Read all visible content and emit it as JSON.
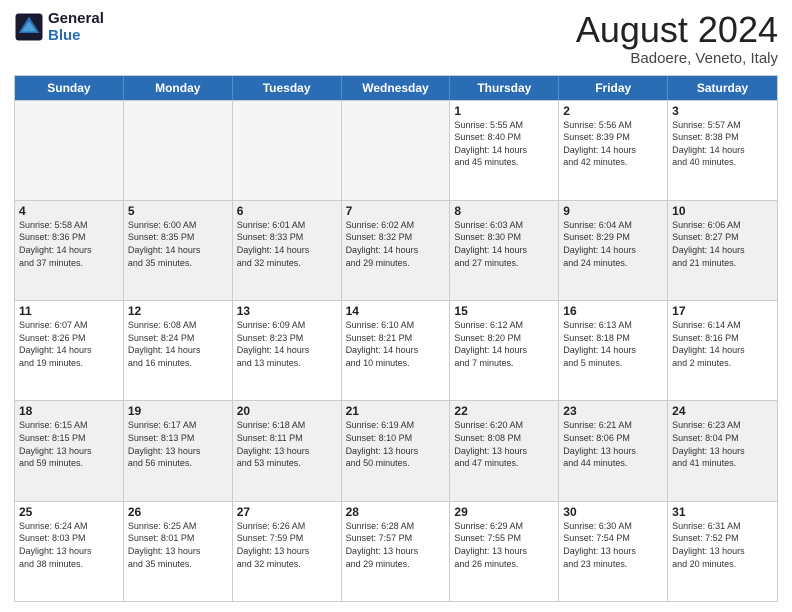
{
  "logo": {
    "line1": "General",
    "line2": "Blue"
  },
  "title": "August 2024",
  "subtitle": "Badoere, Veneto, Italy",
  "days": [
    "Sunday",
    "Monday",
    "Tuesday",
    "Wednesday",
    "Thursday",
    "Friday",
    "Saturday"
  ],
  "rows": [
    [
      {
        "day": "",
        "text": "",
        "empty": true
      },
      {
        "day": "",
        "text": "",
        "empty": true
      },
      {
        "day": "",
        "text": "",
        "empty": true
      },
      {
        "day": "",
        "text": "",
        "empty": true
      },
      {
        "day": "1",
        "text": "Sunrise: 5:55 AM\nSunset: 8:40 PM\nDaylight: 14 hours\nand 45 minutes."
      },
      {
        "day": "2",
        "text": "Sunrise: 5:56 AM\nSunset: 8:39 PM\nDaylight: 14 hours\nand 42 minutes."
      },
      {
        "day": "3",
        "text": "Sunrise: 5:57 AM\nSunset: 8:38 PM\nDaylight: 14 hours\nand 40 minutes."
      }
    ],
    [
      {
        "day": "4",
        "text": "Sunrise: 5:58 AM\nSunset: 8:36 PM\nDaylight: 14 hours\nand 37 minutes."
      },
      {
        "day": "5",
        "text": "Sunrise: 6:00 AM\nSunset: 8:35 PM\nDaylight: 14 hours\nand 35 minutes."
      },
      {
        "day": "6",
        "text": "Sunrise: 6:01 AM\nSunset: 8:33 PM\nDaylight: 14 hours\nand 32 minutes."
      },
      {
        "day": "7",
        "text": "Sunrise: 6:02 AM\nSunset: 8:32 PM\nDaylight: 14 hours\nand 29 minutes."
      },
      {
        "day": "8",
        "text": "Sunrise: 6:03 AM\nSunset: 8:30 PM\nDaylight: 14 hours\nand 27 minutes."
      },
      {
        "day": "9",
        "text": "Sunrise: 6:04 AM\nSunset: 8:29 PM\nDaylight: 14 hours\nand 24 minutes."
      },
      {
        "day": "10",
        "text": "Sunrise: 6:06 AM\nSunset: 8:27 PM\nDaylight: 14 hours\nand 21 minutes."
      }
    ],
    [
      {
        "day": "11",
        "text": "Sunrise: 6:07 AM\nSunset: 8:26 PM\nDaylight: 14 hours\nand 19 minutes."
      },
      {
        "day": "12",
        "text": "Sunrise: 6:08 AM\nSunset: 8:24 PM\nDaylight: 14 hours\nand 16 minutes."
      },
      {
        "day": "13",
        "text": "Sunrise: 6:09 AM\nSunset: 8:23 PM\nDaylight: 14 hours\nand 13 minutes."
      },
      {
        "day": "14",
        "text": "Sunrise: 6:10 AM\nSunset: 8:21 PM\nDaylight: 14 hours\nand 10 minutes."
      },
      {
        "day": "15",
        "text": "Sunrise: 6:12 AM\nSunset: 8:20 PM\nDaylight: 14 hours\nand 7 minutes."
      },
      {
        "day": "16",
        "text": "Sunrise: 6:13 AM\nSunset: 8:18 PM\nDaylight: 14 hours\nand 5 minutes."
      },
      {
        "day": "17",
        "text": "Sunrise: 6:14 AM\nSunset: 8:16 PM\nDaylight: 14 hours\nand 2 minutes."
      }
    ],
    [
      {
        "day": "18",
        "text": "Sunrise: 6:15 AM\nSunset: 8:15 PM\nDaylight: 13 hours\nand 59 minutes."
      },
      {
        "day": "19",
        "text": "Sunrise: 6:17 AM\nSunset: 8:13 PM\nDaylight: 13 hours\nand 56 minutes."
      },
      {
        "day": "20",
        "text": "Sunrise: 6:18 AM\nSunset: 8:11 PM\nDaylight: 13 hours\nand 53 minutes."
      },
      {
        "day": "21",
        "text": "Sunrise: 6:19 AM\nSunset: 8:10 PM\nDaylight: 13 hours\nand 50 minutes."
      },
      {
        "day": "22",
        "text": "Sunrise: 6:20 AM\nSunset: 8:08 PM\nDaylight: 13 hours\nand 47 minutes."
      },
      {
        "day": "23",
        "text": "Sunrise: 6:21 AM\nSunset: 8:06 PM\nDaylight: 13 hours\nand 44 minutes."
      },
      {
        "day": "24",
        "text": "Sunrise: 6:23 AM\nSunset: 8:04 PM\nDaylight: 13 hours\nand 41 minutes."
      }
    ],
    [
      {
        "day": "25",
        "text": "Sunrise: 6:24 AM\nSunset: 8:03 PM\nDaylight: 13 hours\nand 38 minutes."
      },
      {
        "day": "26",
        "text": "Sunrise: 6:25 AM\nSunset: 8:01 PM\nDaylight: 13 hours\nand 35 minutes."
      },
      {
        "day": "27",
        "text": "Sunrise: 6:26 AM\nSunset: 7:59 PM\nDaylight: 13 hours\nand 32 minutes."
      },
      {
        "day": "28",
        "text": "Sunrise: 6:28 AM\nSunset: 7:57 PM\nDaylight: 13 hours\nand 29 minutes."
      },
      {
        "day": "29",
        "text": "Sunrise: 6:29 AM\nSunset: 7:55 PM\nDaylight: 13 hours\nand 26 minutes."
      },
      {
        "day": "30",
        "text": "Sunrise: 6:30 AM\nSunset: 7:54 PM\nDaylight: 13 hours\nand 23 minutes."
      },
      {
        "day": "31",
        "text": "Sunrise: 6:31 AM\nSunset: 7:52 PM\nDaylight: 13 hours\nand 20 minutes."
      }
    ]
  ]
}
